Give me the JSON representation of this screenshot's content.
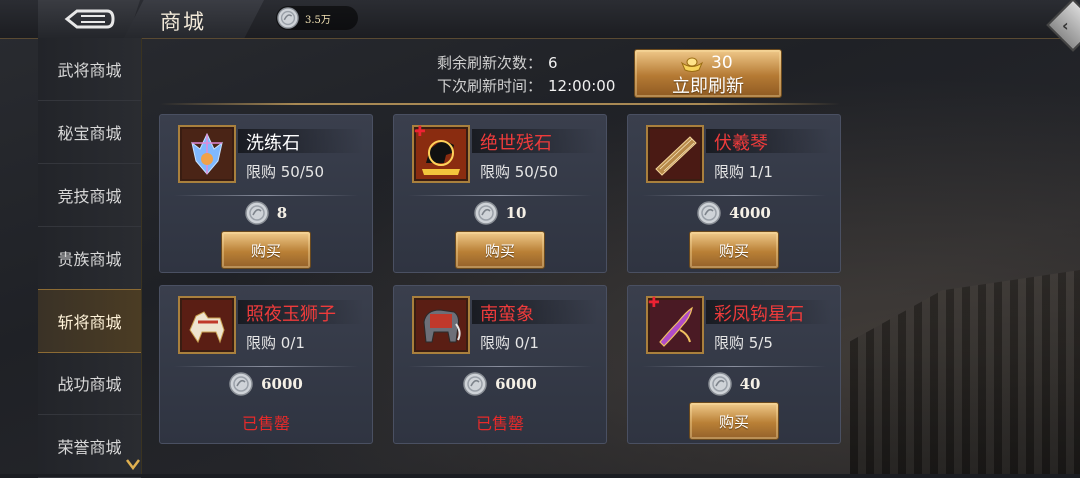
{
  "header": {
    "title": "商城",
    "currency": {
      "icon": "silver-coin-icon",
      "amount": "3.5万"
    }
  },
  "sidebar": {
    "items": [
      {
        "label": "武将商城",
        "active": false
      },
      {
        "label": "秘宝商城",
        "active": false
      },
      {
        "label": "竞技商城",
        "active": false
      },
      {
        "label": "贵族商城",
        "active": false
      },
      {
        "label": "斩将商城",
        "active": true
      },
      {
        "label": "战功商城",
        "active": false
      },
      {
        "label": "荣誉商城",
        "active": false
      }
    ]
  },
  "refresh": {
    "remaining_label": "剩余刷新次数：",
    "remaining_value": "6",
    "next_label": "下次刷新时间：",
    "next_value": "12:00:00",
    "button_cost": "30",
    "button_label": "立即刷新"
  },
  "items": [
    {
      "name": "洗练石",
      "limit": "限购 50/50",
      "price": "8",
      "action": "购买",
      "icon": "crystal-icon",
      "name_color": "#ffffff"
    },
    {
      "name": "绝世残石",
      "limit": "限购 50/50",
      "price": "10",
      "action": "购买",
      "icon": "horse-fragment-icon",
      "name_color": "#ee3b3b"
    },
    {
      "name": "伏羲琴",
      "limit": "限购 1/1",
      "price": "4000",
      "action": "购买",
      "icon": "zither-icon",
      "name_color": "#ee3b3b"
    },
    {
      "name": "照夜玉狮子",
      "limit": "限购 0/1",
      "price": "6000",
      "action": "已售罄",
      "icon": "white-horse-icon",
      "name_color": "#ee3b3b"
    },
    {
      "name": "南蛮象",
      "limit": "限购 0/1",
      "price": "6000",
      "action": "已售罄",
      "icon": "war-elephant-icon",
      "name_color": "#ee3b3b"
    },
    {
      "name": "彩凤钩星石",
      "limit": "限购 5/5",
      "price": "40",
      "action": "购买",
      "icon": "phoenix-hook-icon",
      "name_color": "#ee3b3b"
    }
  ]
}
